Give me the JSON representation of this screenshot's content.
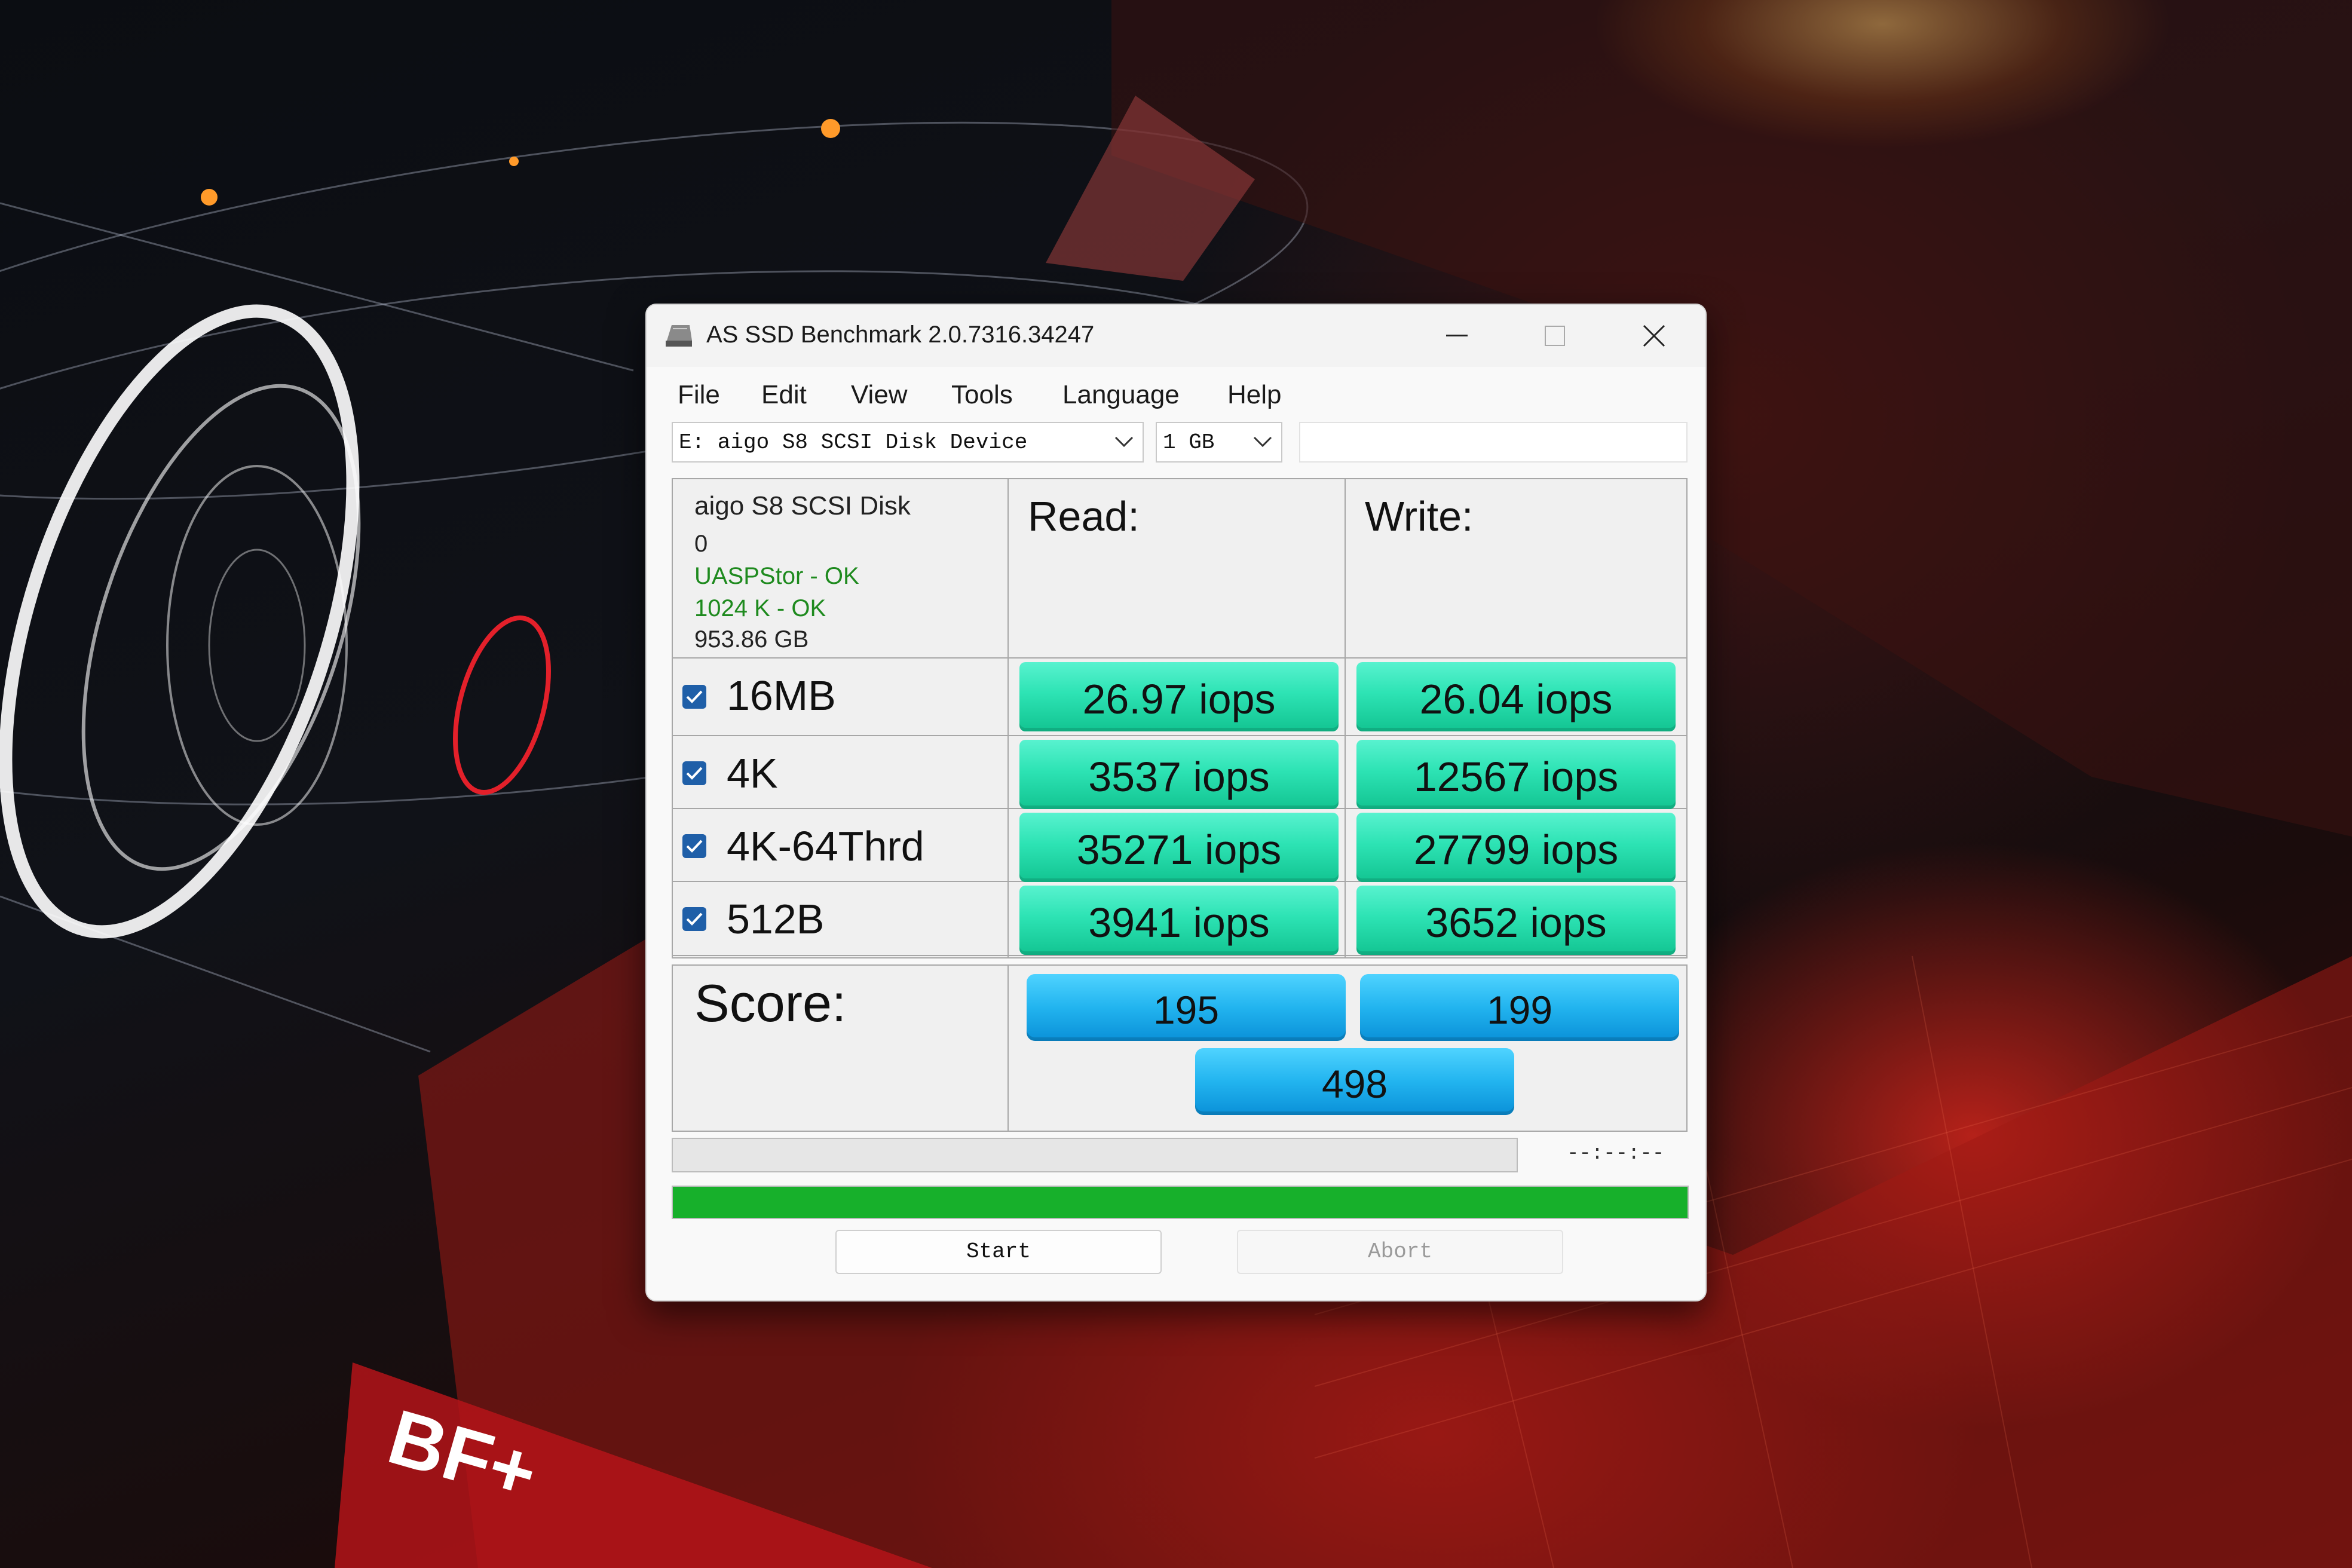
{
  "window": {
    "title": "AS SSD Benchmark 2.0.7316.34247"
  },
  "menu": [
    "File",
    "Edit",
    "View",
    "Tools",
    "Language",
    "Help"
  ],
  "selectors": {
    "drive": "E: aigo S8 SCSI Disk Device",
    "size": "1 GB"
  },
  "drive_info": {
    "name": "aigo S8 SCSI Disk",
    "index": "0",
    "driver_status": "UASPStor - OK",
    "alignment_status": "1024 K - OK",
    "capacity": "953.86 GB"
  },
  "columns": {
    "read": "Read:",
    "write": "Write:"
  },
  "tests": [
    {
      "label": "16MB",
      "checked": true,
      "read": "26.97 iops",
      "write": "26.04 iops"
    },
    {
      "label": "4K",
      "checked": true,
      "read": "3537 iops",
      "write": "12567 iops"
    },
    {
      "label": "4K-64Thrd",
      "checked": true,
      "read": "35271 iops",
      "write": "27799 iops"
    },
    {
      "label": "512B",
      "checked": true,
      "read": "3941 iops",
      "write": "3652 iops"
    }
  ],
  "score": {
    "label": "Score:",
    "read": "195",
    "write": "199",
    "total": "498"
  },
  "progress": {
    "time": "--:--:--",
    "overall_fraction": 1.0
  },
  "buttons": {
    "start": "Start",
    "abort": "Abort"
  },
  "colors": {
    "ok_text": "#1e8a1e",
    "value_green": "#2de3b4",
    "score_blue": "#22b4ef",
    "progress_green": "#17b02b"
  },
  "wallpaper": {
    "logo_text": "BF+"
  }
}
